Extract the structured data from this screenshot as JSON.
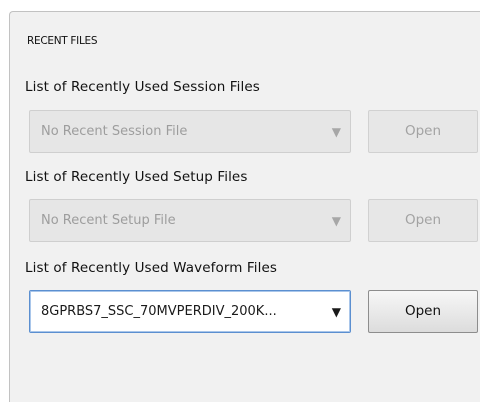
{
  "panel": {
    "title": "RECENT FILES"
  },
  "session": {
    "label": "List of Recently Used Session Files",
    "selected": "No Recent Session File",
    "button": "Open",
    "enabled": false
  },
  "setup": {
    "label": "List of Recently Used Setup Files",
    "selected": "No Recent Setup File",
    "button": "Open",
    "enabled": false
  },
  "waveform": {
    "label": "List of Recently Used Waveform Files",
    "selected": "8GPRBS7_SSC_70MVPERDIV_200K...",
    "button": "Open",
    "enabled": true
  },
  "icons": {
    "dropdown_arrow": "▼"
  },
  "colors": {
    "panel_bg": "#f1f1f1",
    "focus_border": "#5b8fd0",
    "disabled_text": "#9d9d9d"
  }
}
